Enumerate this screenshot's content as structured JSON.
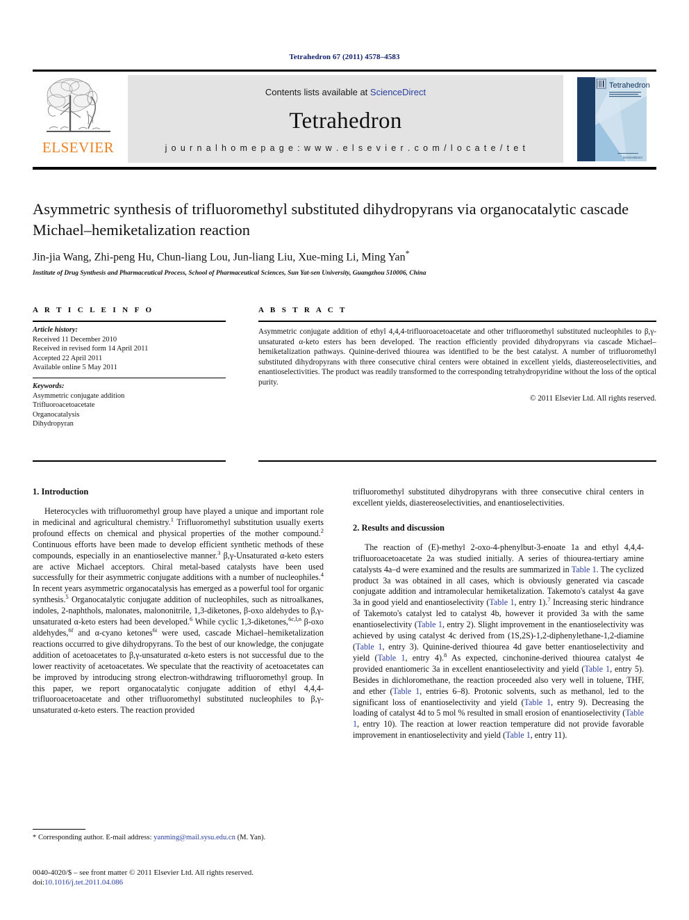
{
  "running_head": "Tetrahedron 67 (2011) 4578–4583",
  "masthead": {
    "contents_prefix": "Contents lists available at ",
    "sciencedirect": "ScienceDirect",
    "journal_name": "Tetrahedron",
    "homepage": "j o u r n a l   h o m e p a g e :   w w w . e l s e v i e r . c o m / l o c a t e / t e t",
    "publisher_wordmark": "ELSEVIER",
    "cover_title": "Tetrahedron",
    "link_color": "#2a3ea0",
    "publisher_color": "#f08020"
  },
  "article": {
    "title": "Asymmetric synthesis of trifluoromethyl substituted dihydropyrans via organocatalytic cascade Michael–hemiketalization reaction",
    "authors": "Jin-jia Wang, Zhi-peng Hu, Chun-liang Lou, Jun-liang Liu, Xue-ming Li, Ming Yan",
    "corresponding_marker": "*",
    "affiliation": "Institute of Drug Synthesis and Pharmaceutical Process, School of Pharmaceutical Sciences, Sun Yat-sen University, Guangzhou 510006, China"
  },
  "article_info": {
    "heading": "A R T I C L E  I N F O",
    "history_label": "Article history:",
    "history": [
      "Received 11 December 2010",
      "Received in revised form 14 April 2011",
      "Accepted 22 April 2011",
      "Available online 5 May 2011"
    ],
    "keywords_label": "Keywords:",
    "keywords": [
      "Asymmetric conjugate addition",
      "Trifluoroacetoacetate",
      "Organocatalysis",
      "Dihydropyran"
    ]
  },
  "abstract": {
    "heading": "A B S T R A C T",
    "text": "Asymmetric conjugate addition of ethyl 4,4,4-trifluoroacetoacetate and other trifluoromethyl substituted nucleophiles to β,γ-unsaturated α-keto esters has been developed. The reaction efficiently provided dihydropyrans via cascade Michael–hemiketalization pathways. Quinine-derived thiourea was identified to be the best catalyst. A number of trifluoromethyl substituted dihydropyrans with three consecutive chiral centers were obtained in excellent yields, diastereoselectivities, and enantioselectivities. The product was readily transformed to the corresponding tetrahydropyridine without the loss of the optical purity.",
    "copyright": "© 2011 Elsevier Ltd. All rights reserved."
  },
  "sections": {
    "introduction_heading": "1. Introduction",
    "results_heading": "2. Results and discussion"
  },
  "columns": {
    "left_para_1_a": "Heterocycles with trifluoromethyl group have played a unique and important role in medicinal and agricultural chemistry.",
    "left_para_1_sup1": "1",
    "left_para_1_b": " Trifluoromethyl substitution usually exerts profound effects on chemical and physical properties of the mother compound.",
    "left_para_1_sup2": "2",
    "left_para_1_c": " Continuous efforts have been made to develop efficient synthetic methods of these compounds, especially in an enantioselective manner.",
    "left_para_1_sup3": "3",
    "left_para_1_d": " β,γ-Unsaturated α-keto esters are active Michael acceptors. Chiral metal-based catalysts have been used successfully for their asymmetric conjugate additions with a number of nucleophiles.",
    "left_para_1_sup4": "4",
    "left_para_1_e": " In recent years asymmetric organocatalysis has emerged as a powerful tool for organic synthesis.",
    "left_para_1_sup5": "5",
    "left_para_1_f": " Organocatalytic conjugate addition of nucleophiles, such as nitroalkanes, indoles, 2-naphthols, malonates, malononitrile, 1,3-diketones, β-oxo aldehydes to β,γ-unsaturated α-keto esters had been developed.",
    "left_para_1_sup6": "6",
    "left_para_1_g": " While cyclic 1,3-diketones,",
    "left_para_1_sup6cln": "6c,l,n",
    "left_para_1_h": " β-oxo aldehydes,",
    "left_para_1_sup6f": "6f",
    "left_para_1_i": " and α-cyano ketones",
    "left_para_1_sup6i": "6i",
    "left_para_1_j": " were used, cascade Michael–hemiketalization reactions occurred to give dihydropyrans. To the best of our knowledge, the conjugate addition of acetoacetates to β,γ-unsaturated α-keto esters is not successful due to the lower reactivity of acetoacetates. We speculate that the reactivity of acetoacetates can be improved by introducing strong electron-withdrawing trifluoromethyl group. In this paper, we report organocatalytic conjugate addition of ethyl 4,4,4-trifluoroacetoacetate and other trifluoromethyl substituted nucleophiles to β,γ-unsaturated α-keto esters. The reaction provided",
    "right_para_cont": "trifluoromethyl substituted dihydropyrans with three consecutive chiral centers in excellent yields, diastereoselectivities, and enantioselectivities.",
    "right_para_2_a": "The reaction of (E)-methyl 2-oxo-4-phenylbut-3-enoate 1a and ethyl 4,4,4-trifluoroacetoacetate 2a was studied initially. A series of thiourea-tertiary amine catalysts 4a–d were examined and the results are summarized in ",
    "right_link_table1_1": "Table 1",
    "right_para_2_b": ". The cyclized product 3a was obtained in all cases, which is obviously generated via cascade conjugate addition and intramolecular hemiketalization. Takemoto's catalyst 4a gave 3a in good yield and enantioselectivity (",
    "right_link_table1_2": "Table 1",
    "right_para_2_c": ", entry 1).",
    "right_sup7": "7",
    "right_para_2_d": " Increasing steric hindrance of Takemoto's catalyst led to catalyst 4b, however it provided 3a with the same enantioselectivity (",
    "right_link_table1_3": "Table 1",
    "right_para_2_e": ", entry 2). Slight improvement in the enantioselectivity was achieved by using catalyst 4c derived from (1S,2S)-1,2-diphenylethane-1,2-diamine (",
    "right_link_table1_4": "Table 1",
    "right_para_2_f": ", entry 3). Quinine-derived thiourea 4d gave better enantioselectivity and yield (",
    "right_link_table1_5": "Table 1",
    "right_para_2_g": ", entry 4).",
    "right_sup8": "8",
    "right_para_2_h": " As expected, cinchonine-derived thiourea catalyst 4e provided enantiomeric 3a in excellent enantioselectivity and yield (",
    "right_link_table1_6": "Table 1",
    "right_para_2_i": ", entry 5). Besides in dichloromethane, the reaction proceeded also very well in toluene, THF, and ether (",
    "right_link_table1_7": "Table 1",
    "right_para_2_j": ", entries 6–8). Protonic solvents, such as methanol, led to the significant loss of enantioselectivity and yield (",
    "right_link_table1_8": "Table 1",
    "right_para_2_k": ", entry 9). Decreasing the loading of catalyst 4d to 5 mol % resulted in small erosion of enantioselectivity (",
    "right_link_table1_9": "Table 1",
    "right_para_2_l": ", entry 10). The reaction at lower reaction temperature did not provide favorable improvement in enantioselectivity and yield (",
    "right_link_table1_10": "Table 1",
    "right_para_2_m": ", entry 11)."
  },
  "footer": {
    "corresponding_star": "*",
    "corresponding_text": " Corresponding author. E-mail address: ",
    "email": "yanming@mail.sysu.edu.cn",
    "corresponding_suffix": " (M. Yan).",
    "colophon_line1": "0040-4020/$ – see front matter © 2011 Elsevier Ltd. All rights reserved.",
    "colophon_doi_label": "doi:",
    "colophon_doi": "10.1016/j.tet.2011.04.086"
  }
}
